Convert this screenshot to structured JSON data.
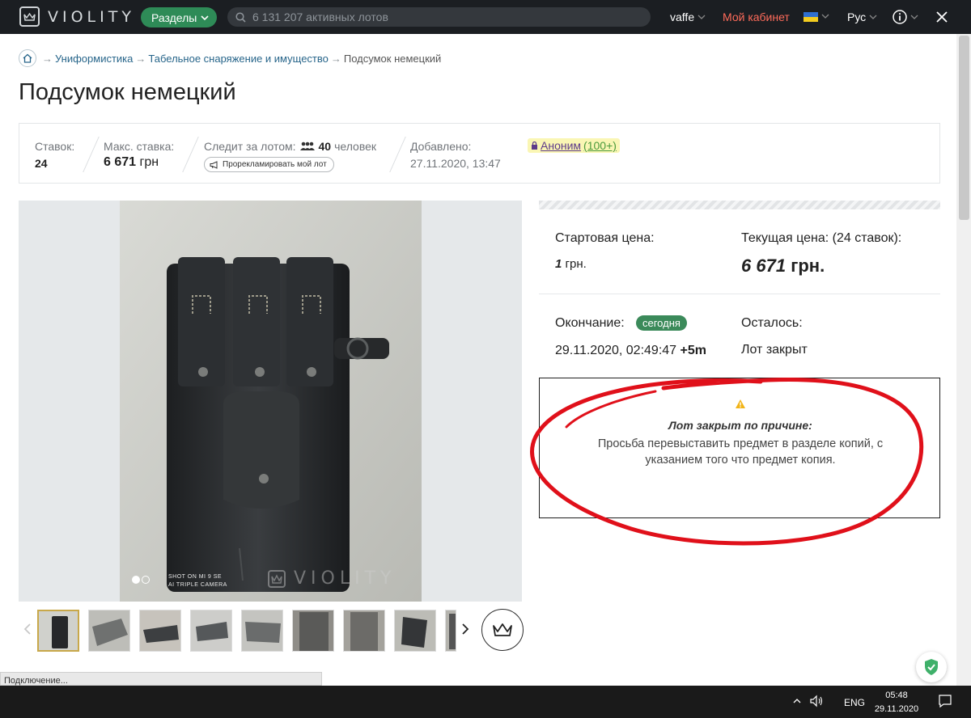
{
  "topbar": {
    "logo_text": "VIOLITY",
    "sections_label": "Разделы",
    "search_placeholder": "6 131 207 активных лотов",
    "username": "vaffe",
    "cabinet_label": "Мой кабинет",
    "language": "Рус",
    "flag_colors": [
      "#2f6fd0",
      "#f3cc20"
    ]
  },
  "breadcrumb": {
    "sep": "→",
    "items": [
      "Униформистика",
      "Табельное снаряжение и имущество"
    ],
    "current": "Подсумок немецкий"
  },
  "lot": {
    "title": "Подсумок немецкий",
    "bids_label": "Ставок:",
    "bids_value": "24",
    "max_bid_label": "Макс. ставка:",
    "max_bid_value": "6 671",
    "max_bid_currency": "грн",
    "watching_label": "Следит за лотом:",
    "watching_count": "40",
    "watching_unit": "человек",
    "promo_label": "Прорекламировать мой лот",
    "added_label": "Добавлено:",
    "added_value": "27.11.2020, 13:47",
    "seller_name": "Аноним",
    "seller_rating": "(100+)"
  },
  "pricing": {
    "start_label": "Стартовая цена:",
    "start_value": "1",
    "start_currency": "грн.",
    "current_label": "Текущая цена: (24 ставок):",
    "current_value": "6 671",
    "current_currency": "грн.",
    "end_label": "Окончание:",
    "end_badge": "сегодня",
    "end_date": "29.11.2020, 02:49:47",
    "end_extra": "+5m",
    "remaining_label": "Осталось:",
    "remaining_value": "Лот закрыт"
  },
  "closed_notice": {
    "title": "Лот закрыт по причине:",
    "text": "Просьба перевыставить предмет в разделе копий, с указанием того что предмет копия."
  },
  "gallery": {
    "photo_caption_line1": "SHOT ON MI 9 SE",
    "photo_caption_line2": "AI TRIPLE CAMERA",
    "watermark": "VIOLITY",
    "thumbnail_count": 9
  },
  "browser": {
    "status_text": "Подключение..."
  },
  "taskbar": {
    "language": "ENG",
    "time": "05:48",
    "date": "29.11.2020"
  },
  "colors": {
    "topbar_bg": "#1b1e22",
    "accent_green": "#2e8b57",
    "cabinet_red": "#ff6b5a",
    "link_blue": "#27658a",
    "annotation_red": "#e0101a"
  }
}
